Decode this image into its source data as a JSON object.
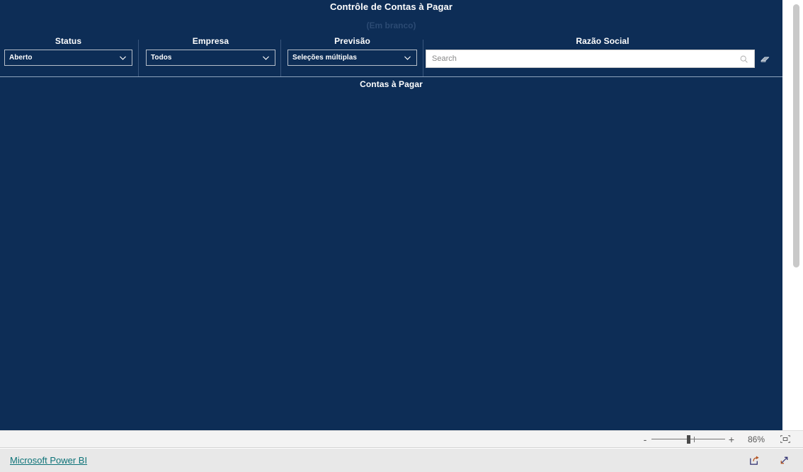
{
  "report": {
    "title": "Contrôle de Contas à Pagar",
    "blank_label": "(Em branco)",
    "section_title": "Contas à Pagar",
    "canvas_color": "#0d2d56"
  },
  "slicers": [
    {
      "id": "status",
      "label": "Status",
      "value": "Aberto",
      "icon": "chevron-down-icon"
    },
    {
      "id": "empresa",
      "label": "Empresa",
      "value": "Todos",
      "icon": "chevron-down-icon"
    },
    {
      "id": "previsao",
      "label": "Previsão",
      "value": "Seleções múltiplas",
      "icon": "chevron-down-icon"
    }
  ],
  "razao_social": {
    "label": "Razão Social",
    "search_placeholder": "Search",
    "search_value": "",
    "search_icon": "search-icon",
    "clear_icon": "eraser-icon"
  },
  "statusbar": {
    "zoom_percent": "86%",
    "zoom_out_label": "-",
    "zoom_in_label": "+",
    "fit_icon": "fit-to-page-icon"
  },
  "footer": {
    "brand_link": "Microsoft Power BI",
    "brand_link_color": "#0d7378",
    "share_icon": "share-icon",
    "fullscreen_icon": "fullscreen-icon"
  }
}
